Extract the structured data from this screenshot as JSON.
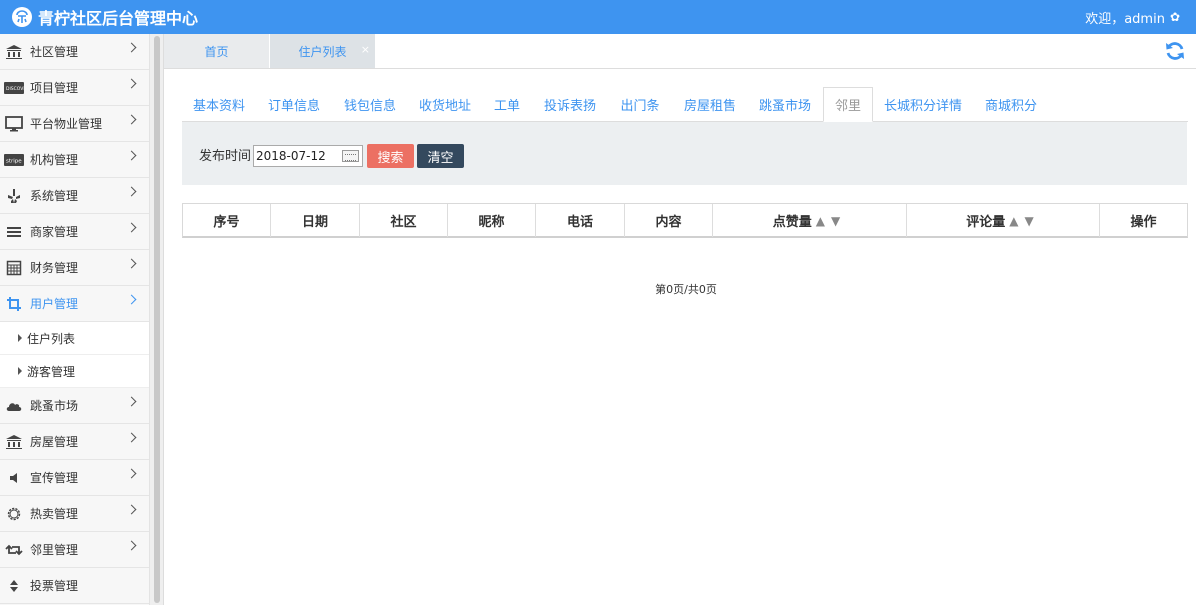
{
  "app": {
    "title": "青柠社区后台管理中心",
    "welcome": "欢迎，admin"
  },
  "sidebar": {
    "items": [
      {
        "label": "社区管理",
        "icon": "bank-icon"
      },
      {
        "label": "项目管理",
        "icon": "discover-card-icon"
      },
      {
        "label": "平台物业管理",
        "icon": "monitor-icon"
      },
      {
        "label": "机构管理",
        "icon": "stripe-icon"
      },
      {
        "label": "系统管理",
        "icon": "yelp-icon"
      },
      {
        "label": "商家管理",
        "icon": "bars-icon"
      },
      {
        "label": "财务管理",
        "icon": "calculator-icon"
      },
      {
        "label": "用户管理",
        "icon": "crop-icon",
        "active": true
      },
      {
        "label": "跳蚤市场",
        "icon": "cloud-icon"
      },
      {
        "label": "房屋管理",
        "icon": "bank-icon"
      },
      {
        "label": "宣传管理",
        "icon": "volume-icon"
      },
      {
        "label": "热卖管理",
        "icon": "gear-icon"
      },
      {
        "label": "邻里管理",
        "icon": "retweet-icon"
      },
      {
        "label": "投票管理",
        "icon": "sort-icon"
      }
    ],
    "user_submenu": [
      {
        "label": "住户列表"
      },
      {
        "label": "游客管理"
      }
    ]
  },
  "page_tabs": [
    {
      "label": "首页"
    },
    {
      "label": "住户列表",
      "active": true,
      "close": "×"
    }
  ],
  "sub_tabs": [
    {
      "label": "基本资料"
    },
    {
      "label": "订单信息"
    },
    {
      "label": "钱包信息"
    },
    {
      "label": "收货地址"
    },
    {
      "label": "工单"
    },
    {
      "label": "投诉表扬"
    },
    {
      "label": "出门条"
    },
    {
      "label": "房屋租售"
    },
    {
      "label": "跳蚤市场"
    },
    {
      "label": "邻里",
      "active": true
    },
    {
      "label": "长城积分详情"
    },
    {
      "label": "商城积分"
    }
  ],
  "search": {
    "label": "发布时间",
    "date_value": "2018-07-12",
    "search_btn": "搜索",
    "clear_btn": "清空"
  },
  "table": {
    "columns": [
      "序号",
      "日期",
      "社区",
      "昵称",
      "电话",
      "内容",
      "点赞量",
      "评论量",
      "操作"
    ],
    "sort_glyph": "▲▼"
  },
  "pager": "第0页/共0页",
  "colors": {
    "primary": "#3e94f0",
    "search_btn": "#ec7063",
    "clear_btn": "#34495e"
  }
}
